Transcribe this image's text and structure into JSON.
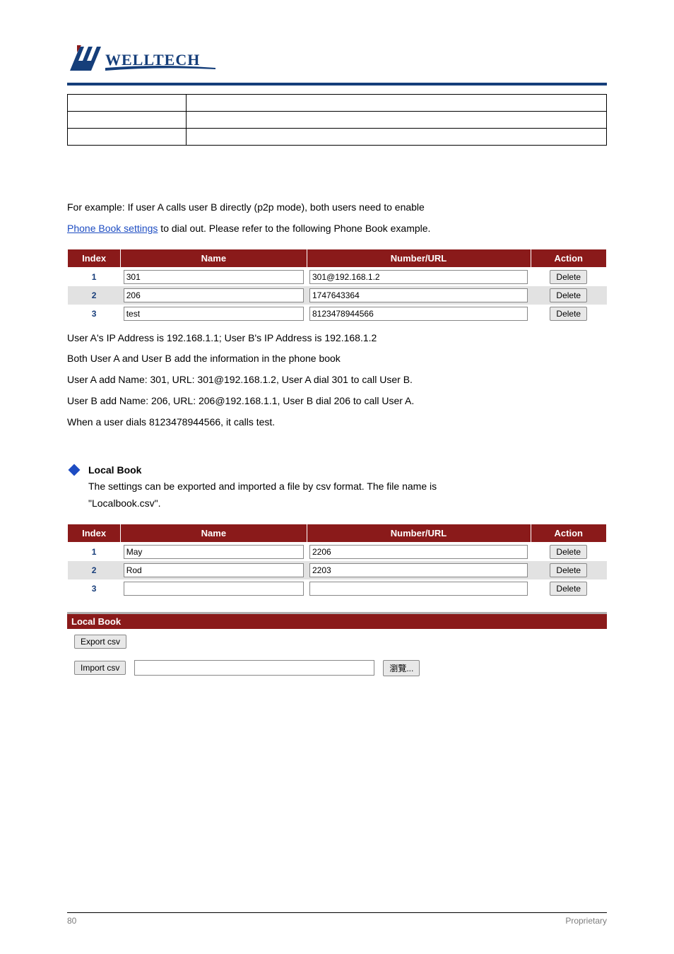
{
  "header": {
    "logo_text": "WELLTECH"
  },
  "info_rows": [
    {
      "left": "",
      "right": ""
    },
    {
      "left": "",
      "right": ""
    },
    {
      "left": "",
      "right": ""
    }
  ],
  "para1": "For example: If user A calls user B directly (p2p mode), both users need to enable",
  "para1_link_label": "Phone Book settings",
  "para1_link": " to dial out. Please refer to the following Phone Book example.",
  "phonebook1": {
    "headers": {
      "index": "Index",
      "name": "Name",
      "url": "Number/URL",
      "action": "Action"
    },
    "rows": [
      {
        "index": "1",
        "name": "301",
        "url": "301@192.168.1.2",
        "action": "Delete"
      },
      {
        "index": "2",
        "name": "206",
        "url": "1747643364",
        "action": "Delete"
      },
      {
        "index": "3",
        "name": "test",
        "url": "8123478944566",
        "action": "Delete"
      }
    ]
  },
  "para2_lines": [
    "User A's IP Address is 192.168.1.1; User B's IP Address is 192.168.1.2",
    "Both User A and User B add the information in the phone book",
    "User A add Name: 301, URL: 301@192.168.1.2, User A dial 301 to call User B.",
    "User B add Name: 206, URL: 206@192.168.1.1, User B dial 206 to call User A.",
    "When a user dials 8123478944566, it calls test."
  ],
  "bullet": {
    "title": "Local Book",
    "lines": [
      "The settings can be exported and imported a file by csv format. The file name is",
      "\"Localbook.csv\"."
    ]
  },
  "phonebook2": {
    "headers": {
      "index": "Index",
      "name": "Name",
      "url": "Number/URL",
      "action": "Action"
    },
    "rows": [
      {
        "index": "1",
        "name": "May",
        "url": "2206",
        "action": "Delete"
      },
      {
        "index": "2",
        "name": "Rod",
        "url": "2203",
        "action": "Delete"
      },
      {
        "index": "3",
        "name": "",
        "url": "",
        "action": "Delete"
      }
    ]
  },
  "local_book_panel": {
    "title": "Local Book",
    "export_btn": "Export csv",
    "import_btn": "Import csv",
    "browse_btn": "瀏覽..."
  },
  "footer": {
    "left": "80",
    "right": "Proprietary"
  }
}
